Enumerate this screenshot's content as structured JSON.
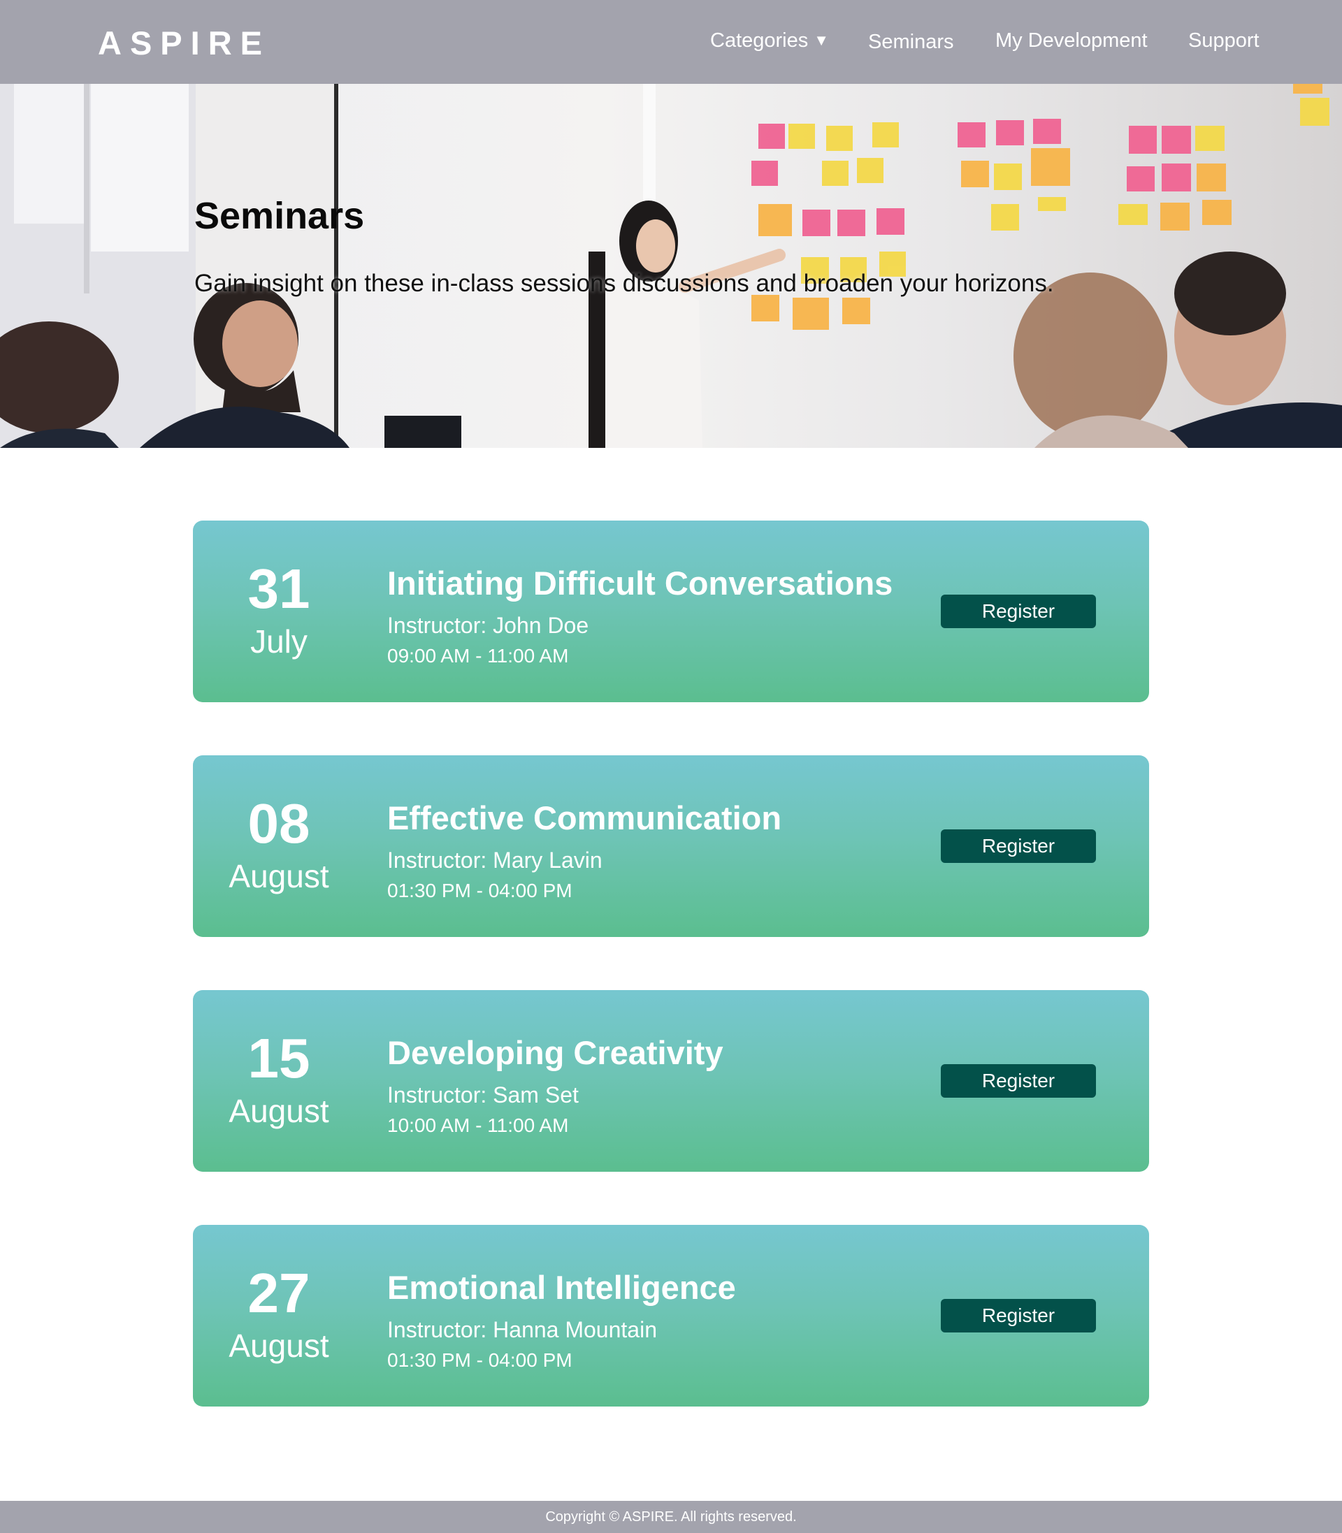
{
  "header": {
    "logo": "ASPIRE",
    "nav": {
      "categories": "Categories",
      "seminars": "Seminars",
      "development": "My Development",
      "support": "Support"
    }
  },
  "hero": {
    "title": "Seminars",
    "subtitle": "Gain insight on these in-class sessions discussions and broaden your horizons."
  },
  "seminars": [
    {
      "day": "31",
      "month": "July",
      "title": "Initiating Difficult Conversations",
      "instructor": "Instructor: John Doe",
      "time": "09:00 AM - 11:00 AM",
      "button": "Register"
    },
    {
      "day": "08",
      "month": "August",
      "title": "Effective Communication",
      "instructor": "Instructor: Mary Lavin",
      "time": "01:30 PM - 04:00 PM",
      "button": "Register"
    },
    {
      "day": "15",
      "month": "August",
      "title": "Developing Creativity",
      "instructor": "Instructor: Sam Set",
      "time": "10:00 AM - 11:00 AM",
      "button": "Register"
    },
    {
      "day": "27",
      "month": "August",
      "title": "Emotional Intelligence",
      "instructor": "Instructor: Hanna Mountain",
      "time": "01:30 PM - 04:00 PM",
      "button": "Register"
    }
  ],
  "footer": {
    "copyright": "Copyright © ASPIRE. All rights reserved."
  },
  "colors": {
    "header_bg": "#a3a3ad",
    "card_gradient_top": "#76c7d0",
    "card_gradient_bottom": "#5bbe8f",
    "button_bg": "#03514a"
  }
}
